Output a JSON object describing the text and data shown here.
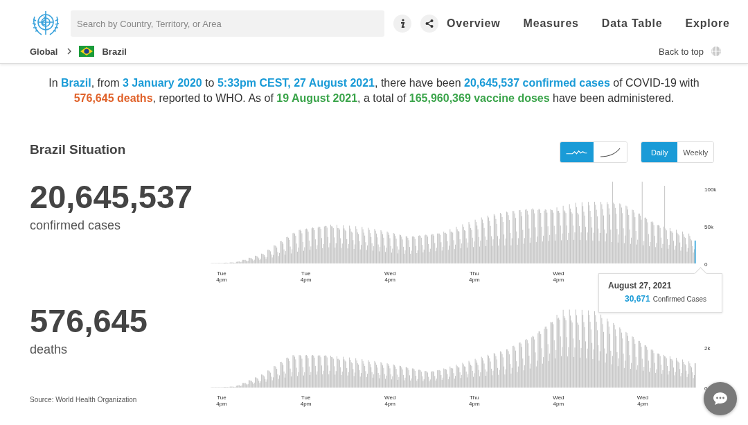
{
  "header": {
    "search": {
      "placeholder": "Search by Country, Territory, or Area"
    },
    "nav": [
      {
        "label": "Overview"
      },
      {
        "label": "Measures"
      },
      {
        "label": "Data Table"
      },
      {
        "label": "Explore"
      }
    ],
    "breadcrumb": [
      {
        "label": "Global"
      },
      {
        "label": "Brazil"
      }
    ],
    "back_to_top": "Back to top"
  },
  "summary": {
    "lines": [
      [
        {
          "text": "In ",
          "kind": "plain"
        },
        {
          "text": "Brazil",
          "kind": "highlight"
        },
        {
          "text": ", from ",
          "kind": "plain"
        },
        {
          "text": "3 January 2020",
          "kind": "highlight"
        },
        {
          "text": " to ",
          "kind": "plain"
        },
        {
          "text": "5:33pm CEST, 27 August 2021",
          "kind": "highlight"
        },
        {
          "text": ", there have been ",
          "kind": "plain"
        },
        {
          "text": "20,645,537 confirmed cases",
          "kind": "highlight"
        },
        {
          "text": " of COVID-19 with",
          "kind": "plain"
        }
      ],
      [
        {
          "text": "576,645 deaths",
          "kind": "deaths"
        },
        {
          "text": ", reported to WHO. As of ",
          "kind": "plain"
        },
        {
          "text": "19 August 2021",
          "kind": "vaccine"
        },
        {
          "text": ", a total of ",
          "kind": "plain"
        },
        {
          "text": "165,960,369 vaccine doses",
          "kind": "vaccine"
        },
        {
          "text": " have been administered.",
          "kind": "plain"
        }
      ]
    ]
  },
  "situation": {
    "title": "Brazil Situation",
    "chart_type_toggle": [
      {
        "kind": "wave",
        "selected": true
      },
      {
        "kind": "curve",
        "selected": false
      }
    ],
    "period_toggle": [
      {
        "label": "Daily",
        "selected": true
      },
      {
        "label": "Weekly",
        "selected": false
      }
    ],
    "panels": [
      {
        "figure": "20,645,537",
        "caption": "confirmed cases",
        "y_labels": [
          "100k",
          "50k",
          "0"
        ],
        "x_labels": [
          {
            "day": "Tue",
            "time": "4pm"
          },
          {
            "day": "Tue",
            "time": "4pm"
          },
          {
            "day": "Wed",
            "time": "4pm"
          },
          {
            "day": "Thu",
            "time": "4pm"
          },
          {
            "day": "Wed",
            "time": "4pm"
          }
        ],
        "tooltip": {
          "date": "August 27, 2021",
          "value": "30,671",
          "label": "Confirmed Cases"
        }
      },
      {
        "figure": "576,645",
        "caption": "deaths",
        "y_labels": [
          "2k",
          "0"
        ],
        "x_labels": [
          {
            "day": "Tue",
            "time": "4pm"
          },
          {
            "day": "Tue",
            "time": "4pm"
          },
          {
            "day": "Wed",
            "time": "4pm"
          },
          {
            "day": "Thu",
            "time": "4pm"
          },
          {
            "day": "Wed",
            "time": "4pm"
          },
          {
            "day": "Wed",
            "time": "4pm"
          }
        ]
      }
    ],
    "source": "Source: World Health Organization"
  }
}
